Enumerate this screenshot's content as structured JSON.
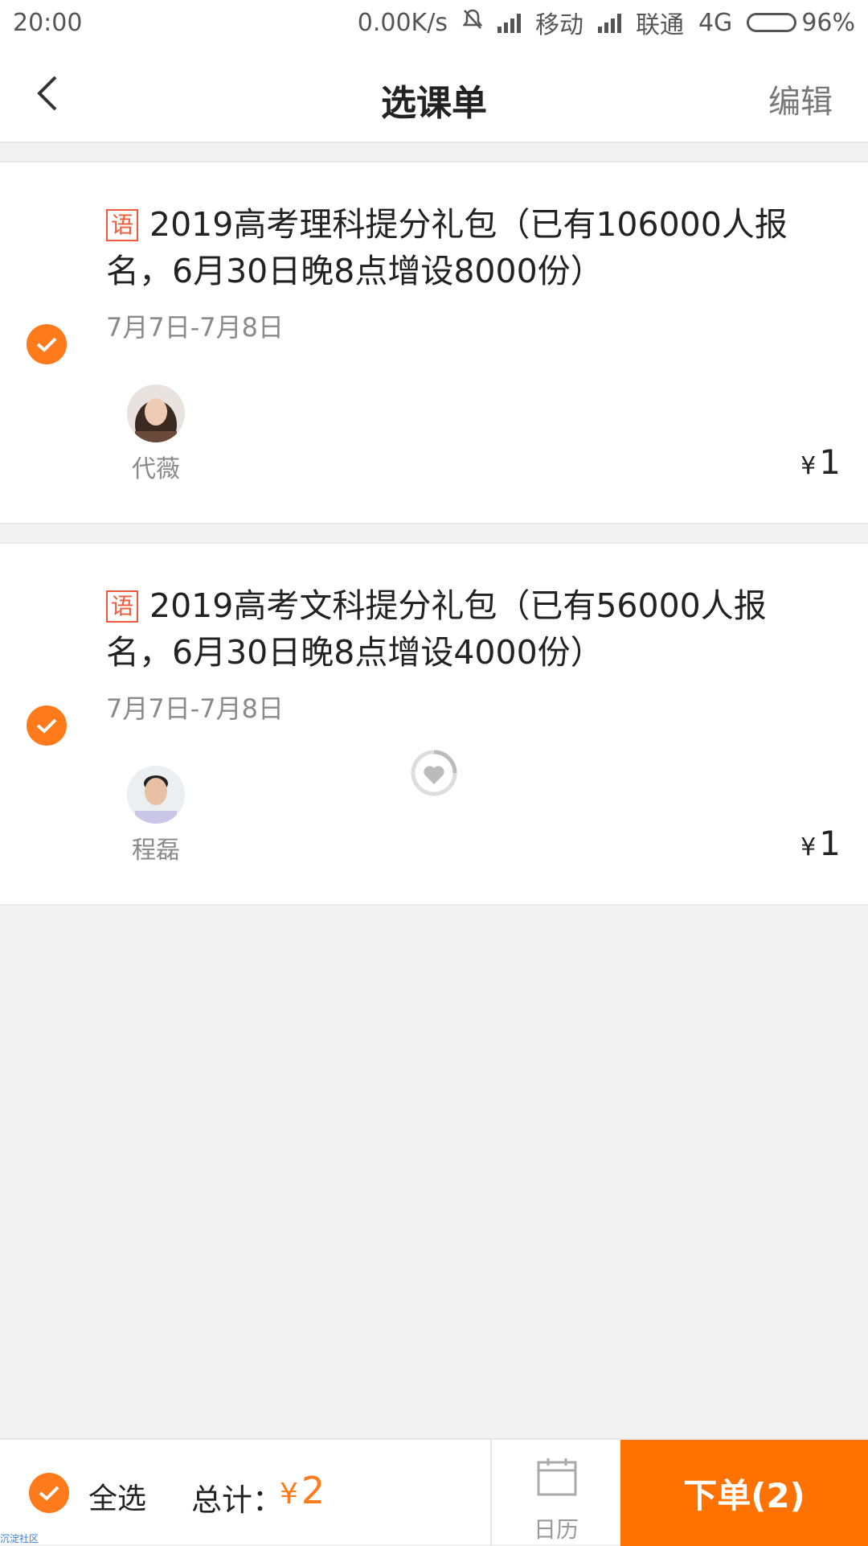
{
  "status_bar": {
    "time": "20:00",
    "speed": "0.00K/s",
    "carrier1": "移动",
    "carrier2": "联通",
    "network": "4G",
    "battery": "96%"
  },
  "header": {
    "title": "选课单",
    "edit_label": "编辑",
    "back_icon": "chevron-left-icon"
  },
  "courses": [
    {
      "subject_tag": "语",
      "title": "2019高考理科提分礼包（已有106000人报名，6月30日晚8点增设8000份）",
      "date_range": "7月7日-7月8日",
      "teacher": "代薇",
      "price_symbol": "¥",
      "price": "1",
      "checked": true
    },
    {
      "subject_tag": "语",
      "title": "2019高考文科提分礼包（已有56000人报名，6月30日晚8点增设4000份）",
      "date_range": "7月7日-7月8日",
      "teacher": "程磊",
      "price_symbol": "¥",
      "price": "1",
      "checked": true
    }
  ],
  "bottom_bar": {
    "select_all_label": "全选",
    "total_label": "总计：",
    "total_symbol": "¥",
    "total_value": "2",
    "calendar_label": "日历",
    "order_label": "下单(2)"
  },
  "watermark": "沉淀社区",
  "colors": {
    "accent": "#ff7200",
    "check": "#ff7a1a",
    "tag": "#f05a3a"
  }
}
